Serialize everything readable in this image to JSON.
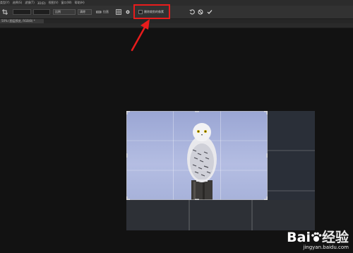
{
  "menubar": {
    "items": [
      "类型(Y)",
      "选择(S)",
      "滤镜(T)",
      "3D(D)",
      "视图(V)",
      "窗口(W)",
      "帮助(H)"
    ]
  },
  "options": {
    "ratio_dropdown": "比例",
    "clear_label": "清除",
    "straighten_label": "拉直",
    "overlay_label": "",
    "checkbox_label": "删除裁剪的像素"
  },
  "document": {
    "tab_label": "50% (图层预览, RGB/8) *"
  },
  "watermark": {
    "brand": "Bai",
    "brand2": "经验",
    "url": "jingyan.baidu.com"
  },
  "colors": {
    "highlight": "#e81c1c",
    "arrow": "#e81c1c"
  }
}
